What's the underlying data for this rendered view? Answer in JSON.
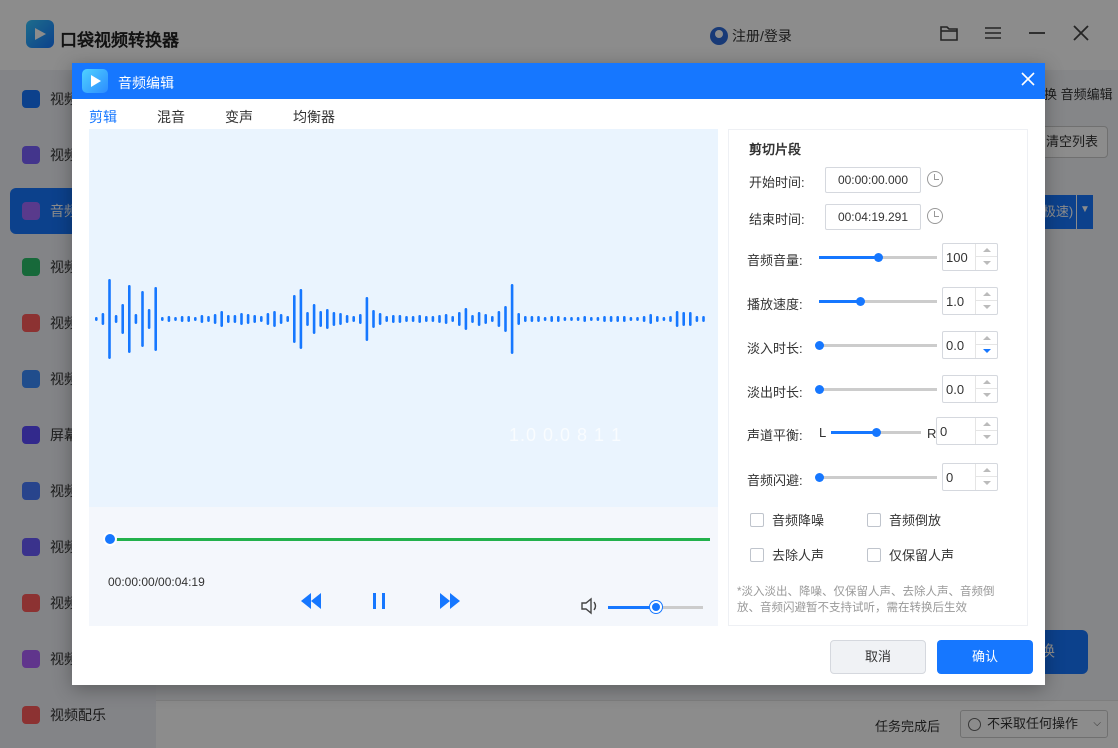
{
  "app": {
    "title": "口袋视频转换器",
    "login_label": "注册/登录",
    "sidebar": [
      {
        "label": "视频",
        "color": "#1677ff",
        "active": false
      },
      {
        "label": "视频",
        "color": "#7b61ff",
        "active": false
      },
      {
        "label": "音频",
        "color": "#a36bff",
        "active": true
      },
      {
        "label": "视频",
        "color": "#2bbf6a",
        "active": false
      },
      {
        "label": "视频",
        "color": "#ff5b5b",
        "active": false
      },
      {
        "label": "视频",
        "color": "#3b8cff",
        "active": false
      },
      {
        "label": "屏幕",
        "color": "#5b4bff",
        "active": false
      },
      {
        "label": "视频",
        "color": "#4a7dff",
        "active": false
      },
      {
        "label": "视频",
        "color": "#6a5bff",
        "active": false
      },
      {
        "label": "视频",
        "color": "#ff5b5b",
        "active": false
      },
      {
        "label": "视频",
        "color": "#b061ff",
        "active": false
      },
      {
        "label": "视频配乐",
        "color": "#ff5b5b",
        "active": false
      }
    ],
    "bg_right_header": "换 音频编辑",
    "bg_clear_list": "清空列表",
    "bg_speed_label": "极速)",
    "bg_convert_label": "换",
    "after_task_label": "任务完成后",
    "after_task_value": "不采取任何操作"
  },
  "dialog": {
    "title": "音频编辑",
    "tabs": [
      {
        "label": "剪辑",
        "active": true
      },
      {
        "label": "混音",
        "active": false
      },
      {
        "label": "变声",
        "active": false
      },
      {
        "label": "均衡器",
        "active": false
      }
    ],
    "player": {
      "time_readout": "00:00:00/00:04:19",
      "progress": 0.0,
      "volume": 0.5,
      "watermark": "1.0 0.0 8 1 1"
    },
    "cut": {
      "section_title": "剪切片段",
      "start_label": "开始时间:",
      "start_value": "00:00:00.000",
      "end_label": "结束时间:",
      "end_value": "00:04:19.291"
    },
    "sliders": [
      {
        "label": "音频音量:",
        "value": "100",
        "fraction": 0.5
      },
      {
        "label": "播放速度:",
        "value": "1.0",
        "fraction": 0.35
      },
      {
        "label": "淡入时长:",
        "value": "0.0",
        "fraction": 0.0
      },
      {
        "label": "淡出时长:",
        "value": "0.0",
        "fraction": 0.0
      },
      {
        "label": "音频闪避:",
        "value": "0",
        "fraction": 0.0
      }
    ],
    "balance": {
      "label": "声道平衡:",
      "left": "L",
      "right": "R",
      "value": "0",
      "fraction": 0.5
    },
    "checkboxes": [
      {
        "label": "音频降噪",
        "checked": false
      },
      {
        "label": "音频倒放",
        "checked": false
      },
      {
        "label": "去除人声",
        "checked": false
      },
      {
        "label": "仅保留人声",
        "checked": false
      }
    ],
    "note": "*淡入淡出、降噪、仅保留人声、去除人声、音频倒放、音频闪避暂不支持试听，需在转换后生效",
    "cancel_label": "取消",
    "ok_label": "确认",
    "accent": "#1677ff",
    "progress_color": "#22b14c"
  }
}
